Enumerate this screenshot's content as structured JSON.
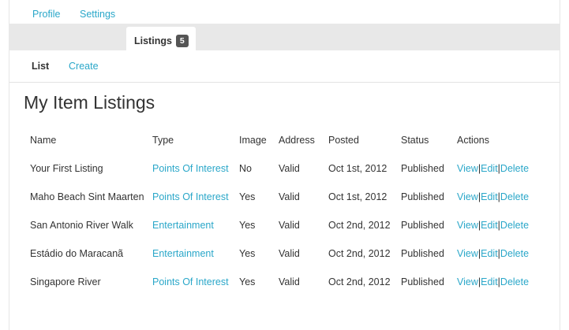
{
  "tabs": [
    {
      "label": "Profile"
    },
    {
      "label": "Settings"
    },
    {
      "label": "Listings",
      "badge": "5"
    }
  ],
  "subnav": [
    {
      "label": "List"
    },
    {
      "label": "Create"
    }
  ],
  "page_title": "My Item Listings",
  "table": {
    "columns": [
      "Name",
      "Type",
      "Image",
      "Address",
      "Posted",
      "Status",
      "Actions"
    ],
    "rows": [
      {
        "name": "Your First Listing",
        "type": "Points Of Interest",
        "image": "No",
        "address": "Valid",
        "posted": "Oct 1st, 2012",
        "status": "Published"
      },
      {
        "name": "Maho Beach Sint Maarten",
        "type": "Points Of Interest",
        "image": "Yes",
        "address": "Valid",
        "posted": "Oct 1st, 2012",
        "status": "Published"
      },
      {
        "name": "San Antonio River Walk",
        "type": "Entertainment",
        "image": "Yes",
        "address": "Valid",
        "posted": "Oct 2nd, 2012",
        "status": "Published"
      },
      {
        "name": "Estádio do Maracanã",
        "type": "Entertainment",
        "image": "Yes",
        "address": "Valid",
        "posted": "Oct 2nd, 2012",
        "status": "Published"
      },
      {
        "name": "Singapore River",
        "type": "Points Of Interest",
        "image": "Yes",
        "address": "Valid",
        "posted": "Oct 2nd, 2012",
        "status": "Published"
      }
    ],
    "actions": {
      "view": "View",
      "edit": "Edit",
      "delete": "Delete",
      "separator": "|"
    }
  },
  "colors": {
    "link": "#2aa7c9",
    "text": "#333333",
    "tabbar": "#e8e8e8",
    "badge": "#555555"
  }
}
